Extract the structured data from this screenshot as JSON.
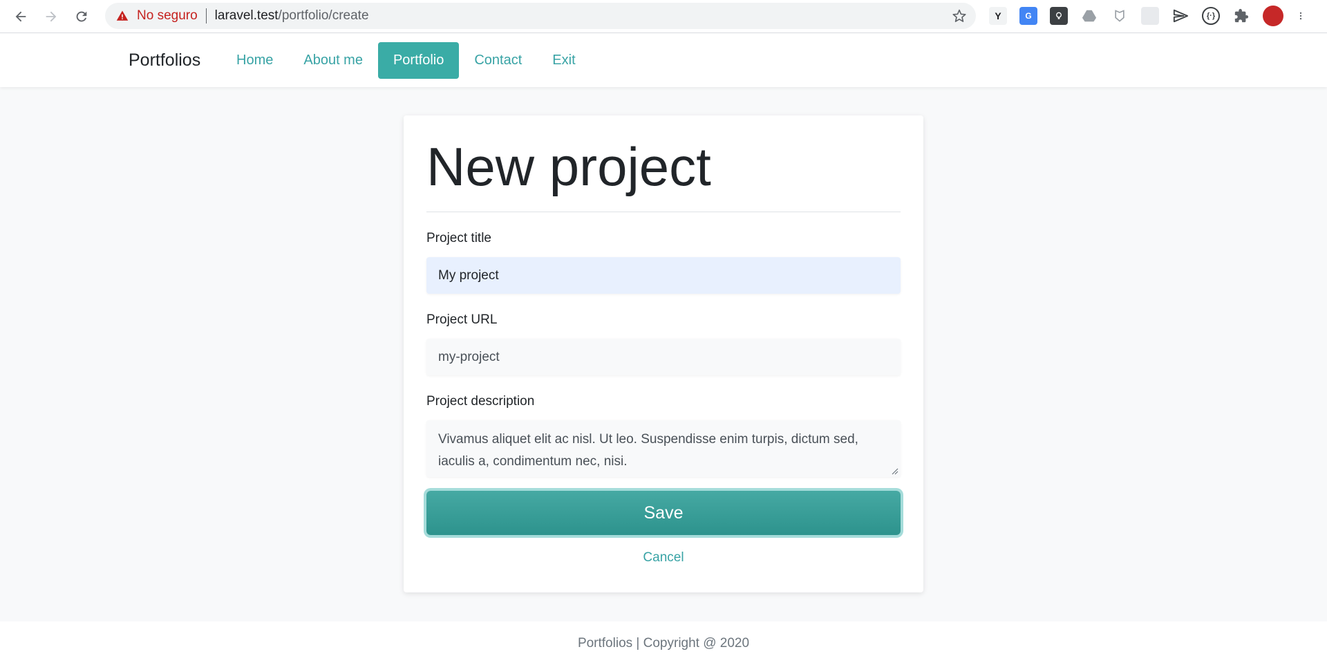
{
  "browser": {
    "security_label": "No seguro",
    "url_host": "laravel.test",
    "url_path": "/portfolio/create",
    "icons": [
      "back-icon",
      "forward-icon",
      "reload-icon",
      "warning-icon",
      "star-icon"
    ],
    "extensions": [
      "y-extension-icon",
      "translate-extension-icon",
      "lightbulb-extension-icon",
      "drive-extension-icon",
      "shield-extension-icon",
      "grid-extension-icon",
      "send-extension-icon",
      "code-extension-icon",
      "puzzle-icon",
      "profile-avatar",
      "menu-icon"
    ]
  },
  "navbar": {
    "brand": "Portfolios",
    "links": [
      {
        "label": "Home",
        "active": false
      },
      {
        "label": "About me",
        "active": false
      },
      {
        "label": "Portfolio",
        "active": true
      },
      {
        "label": "Contact",
        "active": false
      },
      {
        "label": "Exit",
        "active": false
      }
    ]
  },
  "form": {
    "heading": "New project",
    "title_label": "Project title",
    "title_value": "My project",
    "url_label": "Project URL",
    "url_value": "my-project",
    "description_label": "Project description",
    "description_value": "Vivamus aliquet elit ac nisl. Ut leo. Suspendisse enim turpis, dictum sed, iaculis a, condimentum nec, nisi.",
    "save_label": "Save",
    "cancel_label": "Cancel"
  },
  "footer": {
    "text": "Portfolios | Copyright @ 2020"
  },
  "colors": {
    "accent": "#38a3a5",
    "active_nav": "#3aaca6",
    "save_button": "#3a9e98",
    "insecure": "#c5221f"
  }
}
